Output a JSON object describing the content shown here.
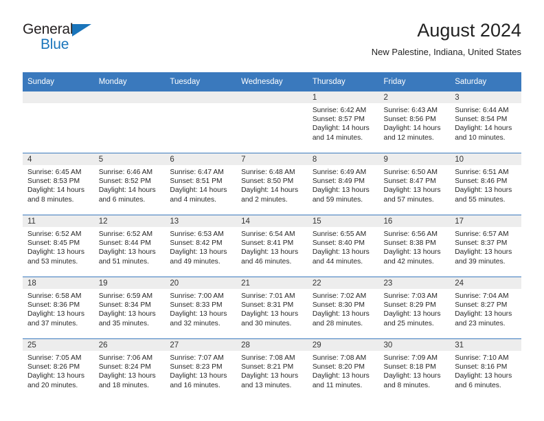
{
  "brand": {
    "line1": "General",
    "line2": "Blue",
    "triangle_color": "#1a75bb"
  },
  "header": {
    "title": "August 2024",
    "subtitle": "New Palestine, Indiana, United States"
  },
  "colors": {
    "header_row": "#3a79bd",
    "daynum_bar": "#ededed",
    "text": "#262626"
  },
  "weekday_headers": [
    "Sunday",
    "Monday",
    "Tuesday",
    "Wednesday",
    "Thursday",
    "Friday",
    "Saturday"
  ],
  "weeks": [
    [
      {
        "day": "",
        "empty": true
      },
      {
        "day": "",
        "empty": true
      },
      {
        "day": "",
        "empty": true
      },
      {
        "day": "",
        "empty": true
      },
      {
        "day": "1",
        "sunrise": "Sunrise: 6:42 AM",
        "sunset": "Sunset: 8:57 PM",
        "daylight_1": "Daylight: 14 hours",
        "daylight_2": "and 14 minutes."
      },
      {
        "day": "2",
        "sunrise": "Sunrise: 6:43 AM",
        "sunset": "Sunset: 8:56 PM",
        "daylight_1": "Daylight: 14 hours",
        "daylight_2": "and 12 minutes."
      },
      {
        "day": "3",
        "sunrise": "Sunrise: 6:44 AM",
        "sunset": "Sunset: 8:54 PM",
        "daylight_1": "Daylight: 14 hours",
        "daylight_2": "and 10 minutes."
      }
    ],
    [
      {
        "day": "4",
        "sunrise": "Sunrise: 6:45 AM",
        "sunset": "Sunset: 8:53 PM",
        "daylight_1": "Daylight: 14 hours",
        "daylight_2": "and 8 minutes."
      },
      {
        "day": "5",
        "sunrise": "Sunrise: 6:46 AM",
        "sunset": "Sunset: 8:52 PM",
        "daylight_1": "Daylight: 14 hours",
        "daylight_2": "and 6 minutes."
      },
      {
        "day": "6",
        "sunrise": "Sunrise: 6:47 AM",
        "sunset": "Sunset: 8:51 PM",
        "daylight_1": "Daylight: 14 hours",
        "daylight_2": "and 4 minutes."
      },
      {
        "day": "7",
        "sunrise": "Sunrise: 6:48 AM",
        "sunset": "Sunset: 8:50 PM",
        "daylight_1": "Daylight: 14 hours",
        "daylight_2": "and 2 minutes."
      },
      {
        "day": "8",
        "sunrise": "Sunrise: 6:49 AM",
        "sunset": "Sunset: 8:49 PM",
        "daylight_1": "Daylight: 13 hours",
        "daylight_2": "and 59 minutes."
      },
      {
        "day": "9",
        "sunrise": "Sunrise: 6:50 AM",
        "sunset": "Sunset: 8:47 PM",
        "daylight_1": "Daylight: 13 hours",
        "daylight_2": "and 57 minutes."
      },
      {
        "day": "10",
        "sunrise": "Sunrise: 6:51 AM",
        "sunset": "Sunset: 8:46 PM",
        "daylight_1": "Daylight: 13 hours",
        "daylight_2": "and 55 minutes."
      }
    ],
    [
      {
        "day": "11",
        "sunrise": "Sunrise: 6:52 AM",
        "sunset": "Sunset: 8:45 PM",
        "daylight_1": "Daylight: 13 hours",
        "daylight_2": "and 53 minutes."
      },
      {
        "day": "12",
        "sunrise": "Sunrise: 6:52 AM",
        "sunset": "Sunset: 8:44 PM",
        "daylight_1": "Daylight: 13 hours",
        "daylight_2": "and 51 minutes."
      },
      {
        "day": "13",
        "sunrise": "Sunrise: 6:53 AM",
        "sunset": "Sunset: 8:42 PM",
        "daylight_1": "Daylight: 13 hours",
        "daylight_2": "and 49 minutes."
      },
      {
        "day": "14",
        "sunrise": "Sunrise: 6:54 AM",
        "sunset": "Sunset: 8:41 PM",
        "daylight_1": "Daylight: 13 hours",
        "daylight_2": "and 46 minutes."
      },
      {
        "day": "15",
        "sunrise": "Sunrise: 6:55 AM",
        "sunset": "Sunset: 8:40 PM",
        "daylight_1": "Daylight: 13 hours",
        "daylight_2": "and 44 minutes."
      },
      {
        "day": "16",
        "sunrise": "Sunrise: 6:56 AM",
        "sunset": "Sunset: 8:38 PM",
        "daylight_1": "Daylight: 13 hours",
        "daylight_2": "and 42 minutes."
      },
      {
        "day": "17",
        "sunrise": "Sunrise: 6:57 AM",
        "sunset": "Sunset: 8:37 PM",
        "daylight_1": "Daylight: 13 hours",
        "daylight_2": "and 39 minutes."
      }
    ],
    [
      {
        "day": "18",
        "sunrise": "Sunrise: 6:58 AM",
        "sunset": "Sunset: 8:36 PM",
        "daylight_1": "Daylight: 13 hours",
        "daylight_2": "and 37 minutes."
      },
      {
        "day": "19",
        "sunrise": "Sunrise: 6:59 AM",
        "sunset": "Sunset: 8:34 PM",
        "daylight_1": "Daylight: 13 hours",
        "daylight_2": "and 35 minutes."
      },
      {
        "day": "20",
        "sunrise": "Sunrise: 7:00 AM",
        "sunset": "Sunset: 8:33 PM",
        "daylight_1": "Daylight: 13 hours",
        "daylight_2": "and 32 minutes."
      },
      {
        "day": "21",
        "sunrise": "Sunrise: 7:01 AM",
        "sunset": "Sunset: 8:31 PM",
        "daylight_1": "Daylight: 13 hours",
        "daylight_2": "and 30 minutes."
      },
      {
        "day": "22",
        "sunrise": "Sunrise: 7:02 AM",
        "sunset": "Sunset: 8:30 PM",
        "daylight_1": "Daylight: 13 hours",
        "daylight_2": "and 28 minutes."
      },
      {
        "day": "23",
        "sunrise": "Sunrise: 7:03 AM",
        "sunset": "Sunset: 8:29 PM",
        "daylight_1": "Daylight: 13 hours",
        "daylight_2": "and 25 minutes."
      },
      {
        "day": "24",
        "sunrise": "Sunrise: 7:04 AM",
        "sunset": "Sunset: 8:27 PM",
        "daylight_1": "Daylight: 13 hours",
        "daylight_2": "and 23 minutes."
      }
    ],
    [
      {
        "day": "25",
        "sunrise": "Sunrise: 7:05 AM",
        "sunset": "Sunset: 8:26 PM",
        "daylight_1": "Daylight: 13 hours",
        "daylight_2": "and 20 minutes."
      },
      {
        "day": "26",
        "sunrise": "Sunrise: 7:06 AM",
        "sunset": "Sunset: 8:24 PM",
        "daylight_1": "Daylight: 13 hours",
        "daylight_2": "and 18 minutes."
      },
      {
        "day": "27",
        "sunrise": "Sunrise: 7:07 AM",
        "sunset": "Sunset: 8:23 PM",
        "daylight_1": "Daylight: 13 hours",
        "daylight_2": "and 16 minutes."
      },
      {
        "day": "28",
        "sunrise": "Sunrise: 7:08 AM",
        "sunset": "Sunset: 8:21 PM",
        "daylight_1": "Daylight: 13 hours",
        "daylight_2": "and 13 minutes."
      },
      {
        "day": "29",
        "sunrise": "Sunrise: 7:08 AM",
        "sunset": "Sunset: 8:20 PM",
        "daylight_1": "Daylight: 13 hours",
        "daylight_2": "and 11 minutes."
      },
      {
        "day": "30",
        "sunrise": "Sunrise: 7:09 AM",
        "sunset": "Sunset: 8:18 PM",
        "daylight_1": "Daylight: 13 hours",
        "daylight_2": "and 8 minutes."
      },
      {
        "day": "31",
        "sunrise": "Sunrise: 7:10 AM",
        "sunset": "Sunset: 8:16 PM",
        "daylight_1": "Daylight: 13 hours",
        "daylight_2": "and 6 minutes."
      }
    ]
  ]
}
